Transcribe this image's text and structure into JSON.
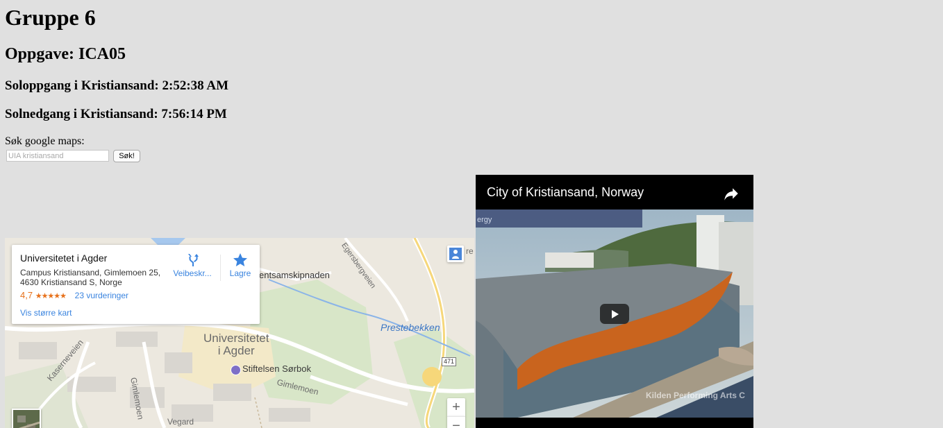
{
  "header": {
    "title": "Gruppe 6",
    "assignment": "Oppgave: ICA05",
    "sunrise": "Soloppgang i Kristiansand: 2:52:38 AM",
    "sunset": "Solnedgang i Kristiansand: 7:56:14 PM"
  },
  "search": {
    "label": "Søk google maps:",
    "placeholder": "UIA kristiansand",
    "value": "",
    "button_label": "Søk!"
  },
  "map": {
    "place_name": "Universitetet i Agder",
    "address": "Campus Kristiansand, Gimlemoen 25, 4630 Kristiansand S, Norge",
    "rating": "4,7",
    "stars": "★★★★★",
    "reviews": "23 vurderinger",
    "larger_map": "Vis større kart",
    "directions_label": "Veibeskr...",
    "save_label": "Lagre",
    "labels": {
      "university": "Universitetet\ni Agder",
      "stream": "Prestebekken",
      "organization": "Stiftelsen Sørbok",
      "studsamskip": "entsamskipnaden",
      "gimlemoen": "Gimlemoen",
      "gimlemoen2": "Gimlemoen",
      "kaserne": "Kaserneveien",
      "bergsveien": "Egersbergveien",
      "vegard": "Vegard",
      "road_number": "471",
      "edge_fragment": "re"
    },
    "zoom_in": "+",
    "zoom_out": "−"
  },
  "video": {
    "title": "City of Kristiansand, Norway",
    "watermark_top": "ergy",
    "watermark_bottom": "Kilden Performing Arts C",
    "colors": {
      "roof": "#c9641e",
      "water": "#3a4d66",
      "sky": "#b9c9d4"
    }
  }
}
